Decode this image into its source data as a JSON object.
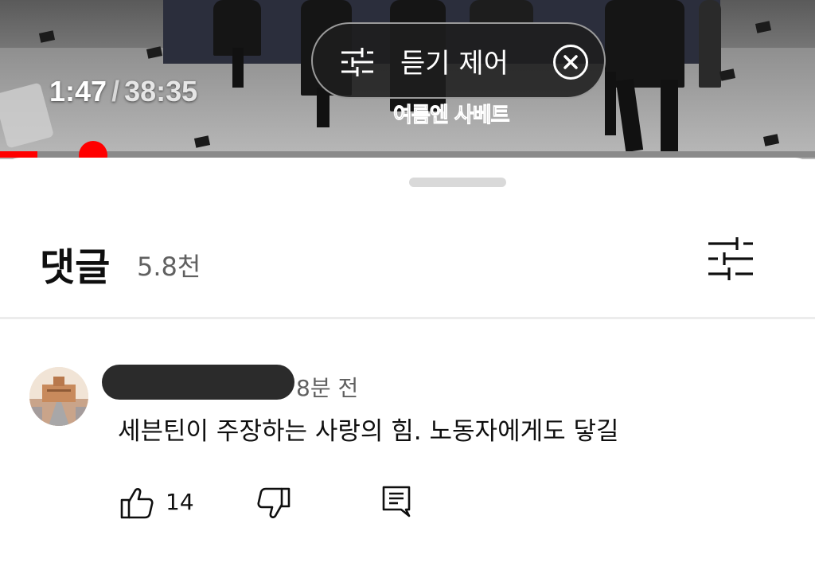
{
  "video": {
    "current_time": "1:47",
    "separator": "/",
    "duration": "38:35",
    "progress_fraction": 0.046,
    "subtitle": "여름엔 사베트",
    "listen_control": {
      "label": "듣기 제어",
      "icons": [
        "tune-icon",
        "close-circle-icon"
      ]
    }
  },
  "comments_panel": {
    "title": "댓글",
    "count": "5.8천",
    "filter_icon": "tune-icon"
  },
  "comments": [
    {
      "author": "",
      "time": "8분 전",
      "text": "세븐틴이 주장하는 사랑의 힘. 노동자에게도 닿길",
      "likes": "14",
      "actions": [
        "thumb-up-icon",
        "thumb-down-icon",
        "reply-icon"
      ]
    }
  ],
  "colors": {
    "accent": "#ff0000",
    "text_primary": "#0f0f0f",
    "text_secondary": "#606060"
  }
}
